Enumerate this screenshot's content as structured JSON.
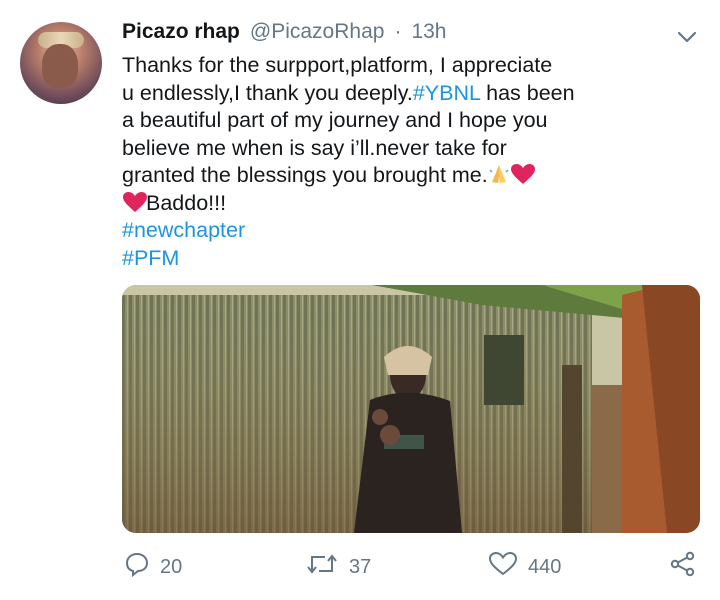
{
  "tweet": {
    "display_name": "Picazo rhap",
    "handle": "@PicazoRhap",
    "separator": "·",
    "timestamp": "13h",
    "lines": [
      "Thanks for the surpport,platform, I appreciate",
      "u endlessly,I thank you deeply.",
      "#YBNL",
      " has been",
      "a beautiful part of my journey and I hope you",
      "believe me when is say i’ll.never take for",
      "granted the blessings you brought me.",
      "Baddo!!!",
      "#newchapter",
      "#PFM"
    ],
    "emoji": [
      "folded-hands",
      "red-heart",
      "red-heart"
    ]
  },
  "actions": {
    "reply_count": "20",
    "retweet_count": "37",
    "like_count": "440"
  },
  "colors": {
    "link": "#1b95e0",
    "muted": "#657786",
    "text": "#14171a",
    "heart": "#e0245e"
  },
  "icons": [
    "chevron-down-icon",
    "reply-icon",
    "retweet-icon",
    "like-icon",
    "share-icon"
  ]
}
